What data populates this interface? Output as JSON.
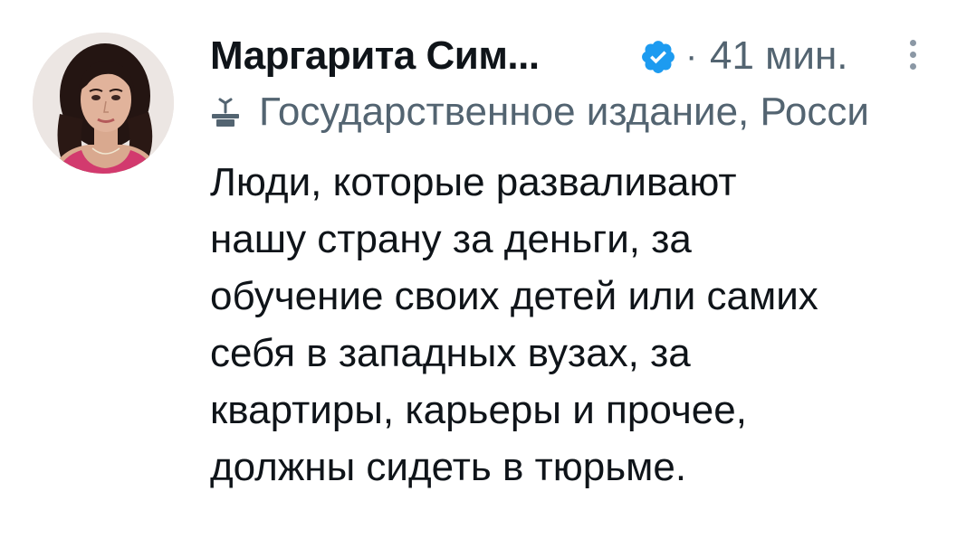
{
  "tweet": {
    "author": {
      "display_name": "Маргарита Сим...",
      "verified": true,
      "avatar": "profile-photo"
    },
    "separator": "·",
    "timestamp": "41 мин.",
    "label": {
      "icon": "state-media-podium-icon",
      "text": "Государственное издание, Росси"
    },
    "text_lines": [
      "Люди, которые разваливают",
      "нашу страну за деньги, за",
      "обучение своих детей или самих",
      "себя в западных вузах, за",
      "квартиры, карьеры и прочее,",
      "должны сидеть в тюрьме."
    ]
  },
  "colors": {
    "text_primary": "#0f1419",
    "text_secondary": "#536471",
    "verified_blue": "#1d9bf0",
    "background": "#ffffff"
  }
}
